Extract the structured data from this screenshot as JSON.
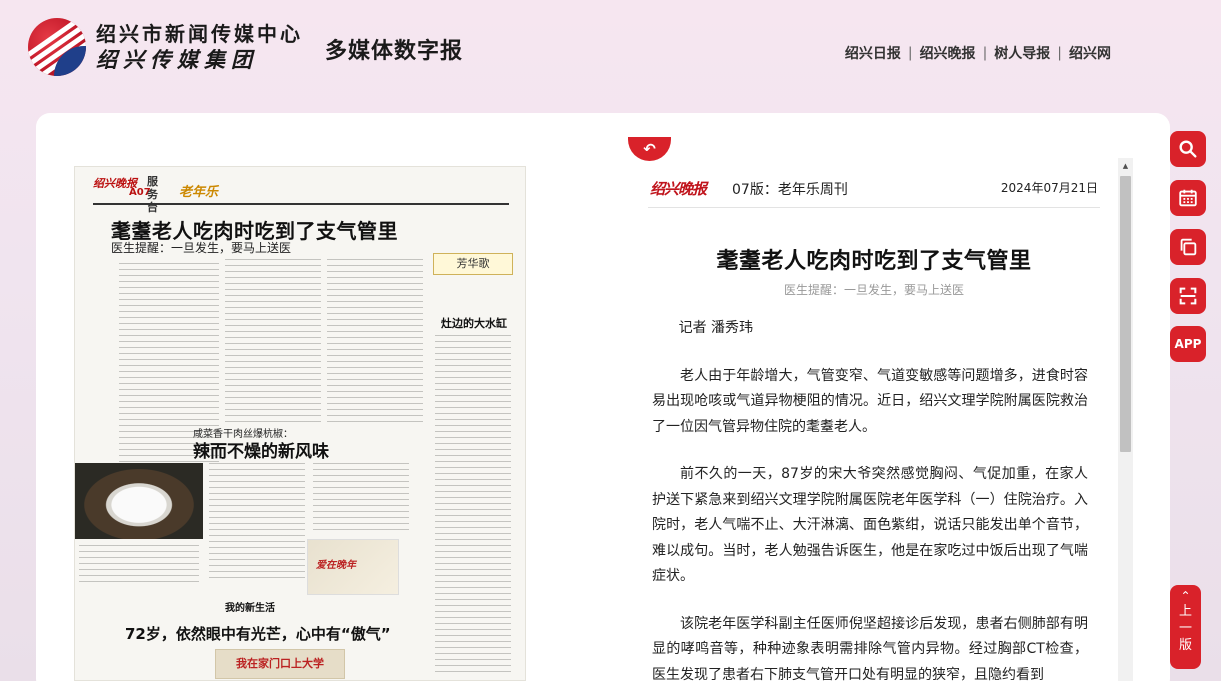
{
  "header": {
    "org_name": "绍兴市新闻传媒中心",
    "org_group": "绍兴传媒集团",
    "site_title": "多媒体数字报",
    "nav": [
      "绍兴日报",
      "绍兴晚报",
      "树人导报",
      "绍兴网"
    ]
  },
  "paper_page": {
    "masthead": "绍兴晚报",
    "page_no": "A07",
    "section": "服务台",
    "section_logo": "老年乐",
    "headline": "耄耋老人吃肉时吃到了支气管里",
    "subhead": "医生提醒：一旦发生，要马上送医",
    "right_column_title": "芳华歌",
    "right_column_story": "灶边的大水缸",
    "mid_kicker": "咸菜香干肉丝爆杭椒：",
    "mid_headline": "辣而不燥的新风味",
    "box_title": "我的新生活",
    "bottom_headline": "72岁，依然眼中有光芒，心中有“傲气”",
    "bottom_image_caption": "我在家门口上大学"
  },
  "article": {
    "paper_logo": "绍兴晚报",
    "edition": "07版：老年乐周刊",
    "date": "2024年07月21日",
    "title": "耄耋老人吃肉时吃到了支气管里",
    "subtitle": "医生提醒：一旦发生，要马上送医",
    "byline": "记者 潘秀玮",
    "paragraphs": [
      "老人由于年龄增大，气管变窄、气道变敏感等问题增多，进食时容易出现呛咳或气道异物梗阻的情况。近日，绍兴文理学院附属医院救治了一位因气管异物住院的耄耋老人。",
      "前不久的一天，87岁的宋大爷突然感觉胸闷、气促加重，在家人护送下紧急来到绍兴文理学院附属医院老年医学科（一）住院治疗。入院时，老人气喘不止、大汗淋漓、面色紫绀，说话只能发出单个音节，难以成句。当时，老人勉强告诉医生，他是在家吃过中饭后出现了气喘症状。",
      "该院老年医学科副主任医师倪坚超接诊后发现，患者右侧肺部有明显的哮鸣音等，种种迹象表明需排除气管内异物。经过胸部CT检查，医生发现了患者右下肺支气管开口处有明显的狭窄，且隐约看到"
    ]
  },
  "tools": {
    "search_icon": "search-icon",
    "calendar_icon": "calendar-icon",
    "copy_icon": "copy-icon",
    "scan_icon": "scan-icon",
    "app_label": "APP",
    "up_edition": "上一版"
  },
  "colors": {
    "accent": "#d9222a",
    "page_bg": "#f3e6ef",
    "card_bg": "#ffffff"
  }
}
